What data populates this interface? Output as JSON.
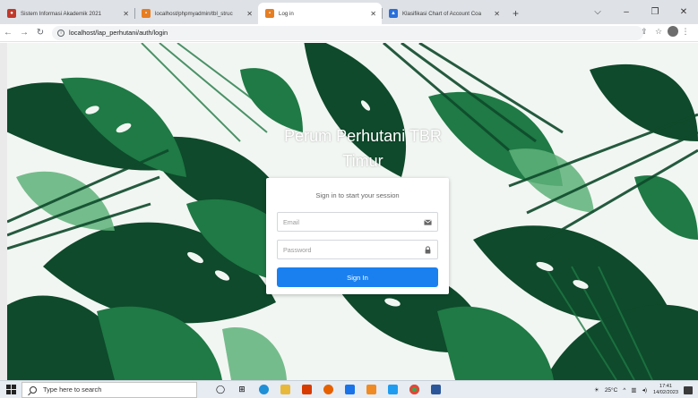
{
  "browser": {
    "tabs": [
      {
        "title": "Sistem Informasi Akademik 2021",
        "favicon_color": "#c0392b",
        "active": false
      },
      {
        "title": "localhost/phpmyadmin/tbl_struc",
        "favicon_color": "#e67e22",
        "active": false
      },
      {
        "title": "Log in",
        "favicon_color": "#e67e22",
        "active": true
      },
      {
        "title": "Klasifikasi Chart of Account Coa",
        "favicon_color": "#2a6fdb",
        "active": false
      }
    ],
    "new_tab_symbol": "+",
    "address": "localhost/lap_perhutani/auth/login"
  },
  "login": {
    "brand_line1": "Perum Perhutani TBR",
    "brand_line2": "Timur",
    "message": "Sign in to start your session",
    "email_placeholder": "Email",
    "password_placeholder": "Password",
    "submit_label": "Sign In"
  },
  "taskbar": {
    "search_placeholder": "Type here to search",
    "temperature": "25°C",
    "time": "17:41",
    "date": "14/02/2023"
  },
  "colors": {
    "accent": "#1a80f0",
    "leaf_dark": "#0e4a2b",
    "leaf_mid": "#1f7a45",
    "leaf_light": "#5fb27a"
  }
}
